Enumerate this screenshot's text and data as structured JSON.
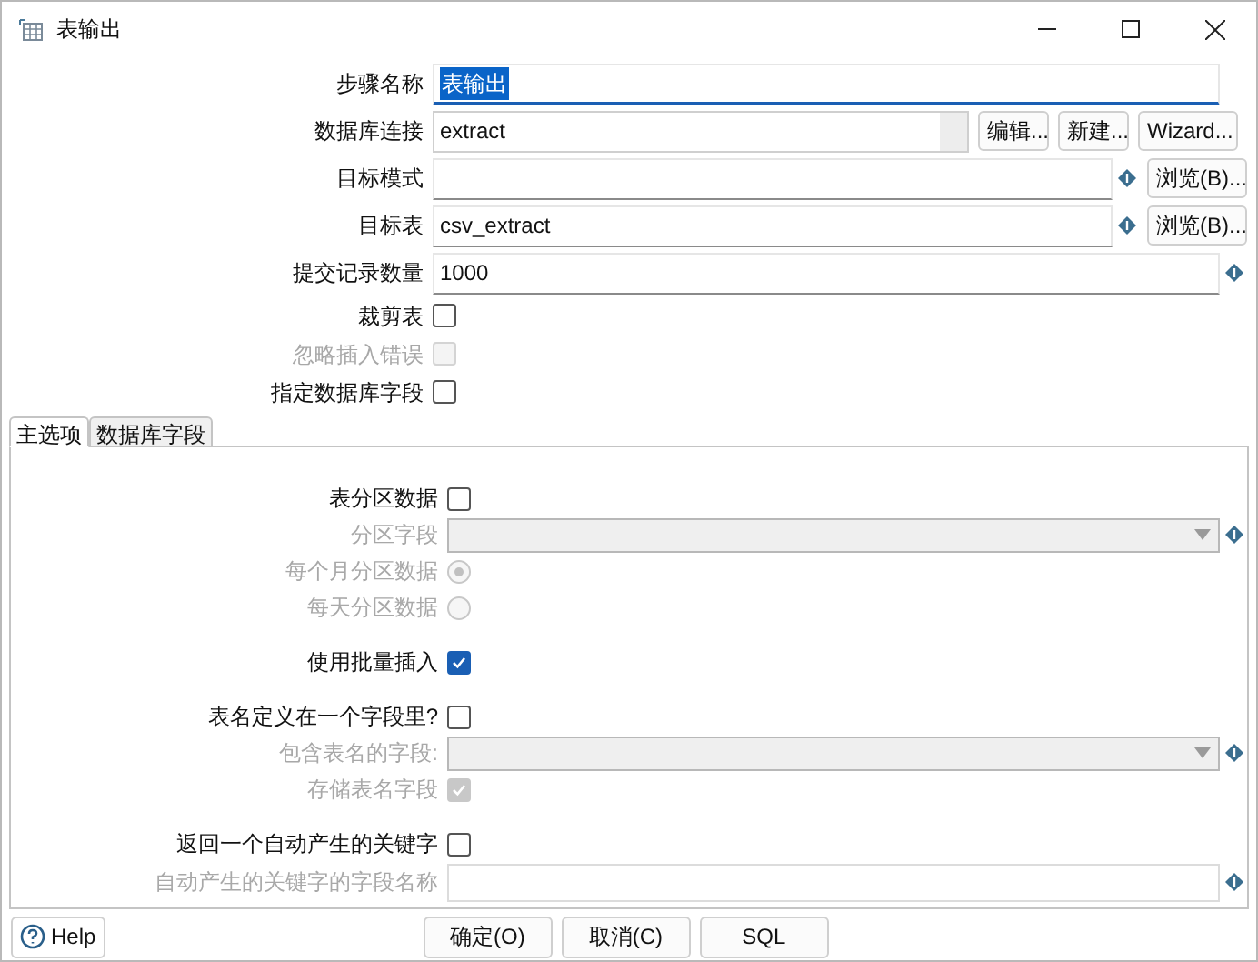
{
  "window": {
    "title": "表输出"
  },
  "fields": [
    {
      "kind": "text",
      "label": "步骤名称",
      "value": "表输出",
      "highlighted": true
    },
    {
      "kind": "connection",
      "label": "数据库连接",
      "value": "extract",
      "buttons": [
        "编辑...",
        "新建...",
        "Wizard..."
      ]
    },
    {
      "kind": "text",
      "label": "目标模式",
      "variable": true,
      "button": "浏览(B)..."
    },
    {
      "kind": "text",
      "label": "目标表",
      "value": "csv_extract",
      "variable": true,
      "button": "浏览(B)..."
    },
    {
      "kind": "text",
      "label": "提交记录数量",
      "value": "1000",
      "variable": true
    },
    {
      "kind": "checkbox",
      "label": "裁剪表",
      "checked": false,
      "disabled": false
    },
    {
      "kind": "checkbox",
      "label": "忽略插入错误",
      "checked": false,
      "disabled": true
    },
    {
      "kind": "checkbox",
      "label": "指定数据库字段",
      "checked": false,
      "disabled": false
    }
  ],
  "tabs": [
    {
      "label": "主选项",
      "selected": true
    },
    {
      "label": "数据库字段",
      "selected": false
    }
  ],
  "option_groups": [
    [
      {
        "kind": "checkbox",
        "label": "表分区数据",
        "checked": false,
        "disabled": false
      },
      {
        "kind": "combo",
        "label": "分区字段",
        "disabled": true,
        "variable": true
      },
      {
        "kind": "radio",
        "label": "每个月分区数据",
        "selected": true,
        "disabled": true
      },
      {
        "kind": "radio",
        "label": "每天分区数据",
        "selected": false,
        "disabled": true
      }
    ],
    [
      {
        "kind": "checkbox",
        "label": "使用批量插入",
        "checked": true,
        "disabled": false
      }
    ],
    [
      {
        "kind": "checkbox",
        "label": "表名定义在一个字段里?",
        "checked": false,
        "disabled": false
      },
      {
        "kind": "combo",
        "label": "包含表名的字段:",
        "disabled": true,
        "variable": true
      },
      {
        "kind": "checkbox",
        "label": "存储表名字段",
        "checked": true,
        "disabled": true
      }
    ],
    [
      {
        "kind": "checkbox",
        "label": "返回一个自动产生的关键字",
        "checked": false,
        "disabled": false
      },
      {
        "kind": "text",
        "label": "自动产生的关键字的字段名称",
        "disabled": true,
        "variable": true
      }
    ]
  ],
  "footer": {
    "help": "Help",
    "buttons": [
      "确定(O)",
      "取消(C)",
      "SQL"
    ]
  }
}
